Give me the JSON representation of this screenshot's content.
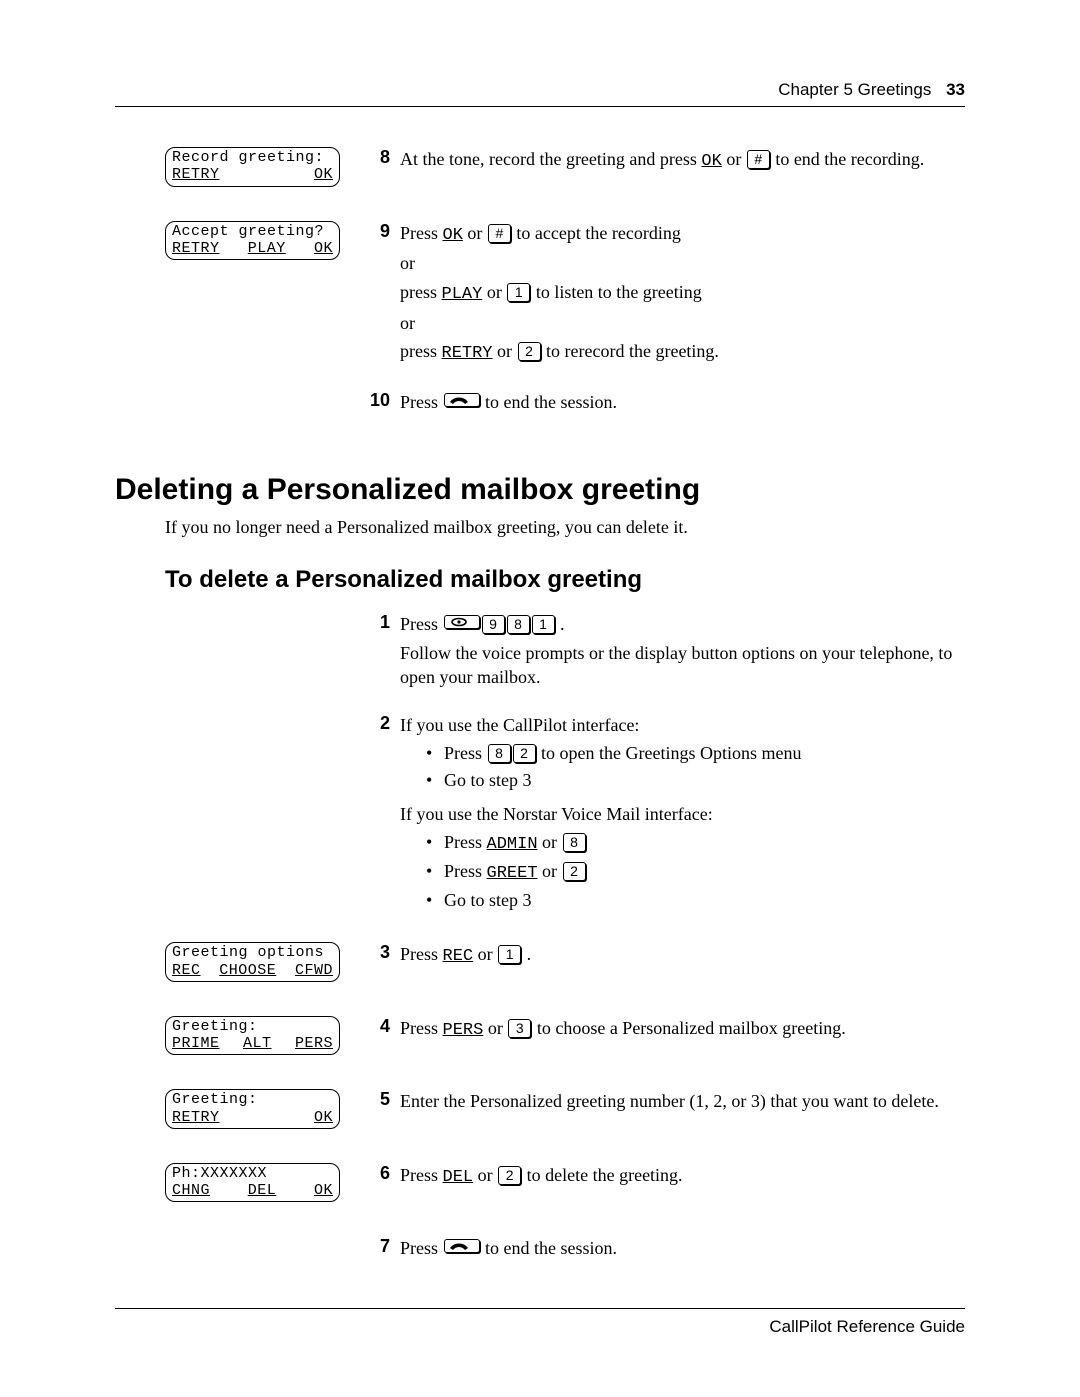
{
  "header": {
    "chapter": "Chapter 5  Greetings",
    "page": "33"
  },
  "footer": {
    "text": "CallPilot Reference Guide"
  },
  "lcd": {
    "record": {
      "top": "Record greeting:",
      "s1": "RETRY",
      "s2": "",
      "s3": "OK"
    },
    "accept": {
      "top": "Accept greeting?",
      "s1": "RETRY",
      "s2": "PLAY",
      "s3": "OK"
    },
    "opts": {
      "top": "Greeting options",
      "s1": "REC",
      "s2": "CHOOSE",
      "s3": "CFWD"
    },
    "greet": {
      "top": "Greeting:",
      "s1": "PRIME",
      "s2": "ALT",
      "s3": "PERS"
    },
    "greetok": {
      "top": "Greeting:",
      "s1": "RETRY",
      "s2": "",
      "s3": "OK"
    },
    "ph": {
      "top": "Ph:XXXXXXX",
      "s1": "CHNG",
      "s2": "DEL",
      "s3": "OK"
    }
  },
  "top_steps": {
    "s8": {
      "n": "8",
      "t1": "At the tone, record the greeting and press ",
      "ok": "OK",
      "or": " or ",
      "hash": "#",
      "t2": "  to end the recording."
    },
    "s9": {
      "n": "9",
      "a1": "Press ",
      "ok": "OK",
      "or1": " or ",
      "hash": "#",
      "a2": "  to accept the recording",
      "or": "or",
      "b1": "press ",
      "play": "PLAY",
      "or2": " or ",
      "one": "1",
      "b2": "  to listen to the greeting",
      "c1": "press ",
      "retry": "RETRY",
      "or3": " or ",
      "two": "2",
      "c2": "  to rerecord the greeting."
    },
    "s10": {
      "n": "10",
      "t1": "Press ",
      "t2": " to end the session."
    }
  },
  "section": {
    "h1": "Deleting a Personalized mailbox greeting",
    "intro": "If you no longer need a Personalized mailbox greeting, you can delete it.",
    "h2": "To delete a Personalized mailbox greeting"
  },
  "del_steps": {
    "s1": {
      "n": "1",
      "t1": "Press ",
      "k_nine": "9",
      "k_eight": "8",
      "k_one": "1",
      "dot": " .",
      "t2": "Follow the voice prompts or the display button options on your telephone, to open your mailbox."
    },
    "s2": {
      "n": "2",
      "if_cp": "If you use the CallPilot interface:",
      "b1a": "Press ",
      "k8": "8",
      "k2": "2",
      "b1b": "  to open the Greetings Options menu",
      "b2": "Go to step 3",
      "if_nv": "If you use the Norstar Voice Mail interface:",
      "c1a": "Press ",
      "admin": "ADMIN",
      "or1": " or ",
      "k8b": "8",
      "c2a": "Press ",
      "greet": "GREET",
      "or2": " or ",
      "k2b": "2",
      "c3": "Go to step 3"
    },
    "s3": {
      "n": "3",
      "t1": "Press ",
      "rec": "REC",
      "or": " or ",
      "k1": "1",
      "dot": " ."
    },
    "s4": {
      "n": "4",
      "t1": "Press ",
      "pers": "PERS",
      "or": " or ",
      "k3": "3",
      "t2": "  to choose a Personalized mailbox greeting."
    },
    "s5": {
      "n": "5",
      "t": "Enter the Personalized greeting number (1, 2, or 3) that you want to delete."
    },
    "s6": {
      "n": "6",
      "t1": "Press ",
      "del": "DEL",
      "or": " or ",
      "k2": "2",
      "t2": "  to delete the greeting."
    },
    "s7": {
      "n": "7",
      "t1": "Press ",
      "t2": " to end the session."
    }
  }
}
